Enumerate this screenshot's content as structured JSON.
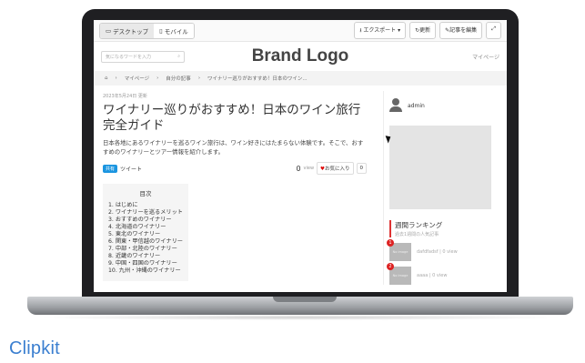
{
  "toolbar": {
    "desktop_label": "デスクトップ",
    "mobile_label": "モバイル",
    "export_label": "エクスポート",
    "refresh_label": "更新",
    "edit_label": "記事を編集"
  },
  "header": {
    "search_placeholder": "気になるワードを入力",
    "logo": "Brand Logo",
    "mypage": "マイページ"
  },
  "breadcrumb": [
    "マイページ",
    "自分の記事",
    "ワイナリー巡りがおすすめ！日本のワイン..."
  ],
  "article": {
    "date": "2023年5月24日 更新",
    "title": "ワイナリー巡りがおすすめ！日本のワイン旅行完全ガイド",
    "lead": "日本各地にあるワイナリーを巡るワイン旅行は、ワイン好きにはたまらない体験です。そこで、おすすめのワイナリーとツアー情報を紹介します。",
    "tweet_badge": "共有",
    "tweet_label": "ツイート",
    "views": "0",
    "views_unit": "view",
    "fav_label": "お気に入り",
    "fav_count": "0"
  },
  "toc": {
    "heading": "目次",
    "items": [
      "1. はじめに",
      "2. ワイナリーを巡るメリット",
      "3. おすすめのワイナリー",
      "4. 北海道のワイナリー",
      "5. 東北のワイナリー",
      "6. 関東・甲信越のワイナリー",
      "7. 中部・北陸のワイナリー",
      "8. 近畿のワイナリー",
      "9. 中国・四国のワイナリー",
      "10. 九州・沖縄のワイナリー"
    ]
  },
  "sidebar": {
    "author": "admin",
    "ranking_title": "週間ランキング",
    "ranking_sub": "過去1週間の人気記事",
    "ranking": [
      {
        "rank": "1",
        "thumb": "No image",
        "text": "dafdfadsf | 0 view"
      },
      {
        "rank": "2",
        "thumb": "No image",
        "text": "aaaa | 0 view"
      }
    ]
  },
  "brand": {
    "name": "Clipkit",
    "accent": "#3b7fd0"
  }
}
